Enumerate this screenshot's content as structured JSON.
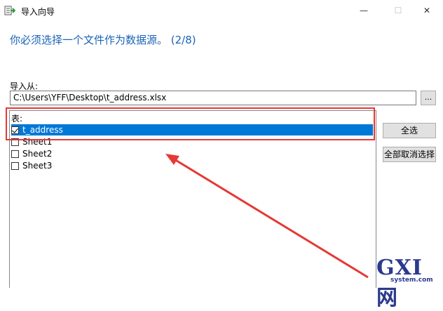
{
  "window": {
    "title": "导入向导",
    "min_glyph": "—",
    "max_glyph": "☐",
    "close_glyph": "✕"
  },
  "heading": "你必须选择一个文件作为数据源。 (2/8)",
  "import_from": {
    "label": "导入从:",
    "path": "C:\\Users\\YFF\\Desktop\\t_address.xlsx",
    "browse_label": "..."
  },
  "tables": {
    "label": "表:",
    "items": [
      {
        "name": "t_address",
        "checked": true,
        "selected": true
      },
      {
        "name": "Sheet1",
        "checked": false,
        "selected": false
      },
      {
        "name": "Sheet2",
        "checked": false,
        "selected": false
      },
      {
        "name": "Sheet3",
        "checked": false,
        "selected": false
      }
    ]
  },
  "buttons": {
    "select_all": "全选",
    "deselect_all": "全部取消选择"
  },
  "watermark": {
    "main": "GXI网",
    "sub": "system.com"
  },
  "colors": {
    "heading": "#1a63b8",
    "selection": "#0078d7",
    "annotation": "#e53935"
  }
}
